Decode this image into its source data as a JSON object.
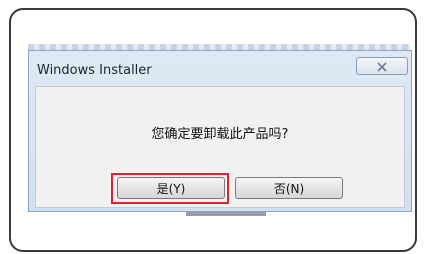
{
  "dialog": {
    "title": "Windows Installer",
    "message": "您确定要卸载此产品吗?",
    "yes_label": "是(Y)",
    "no_label": "否(N)",
    "close_icon": "close-x-icon"
  },
  "colors": {
    "highlight": "#d9262b",
    "titlebar": "#d3e0ef"
  }
}
